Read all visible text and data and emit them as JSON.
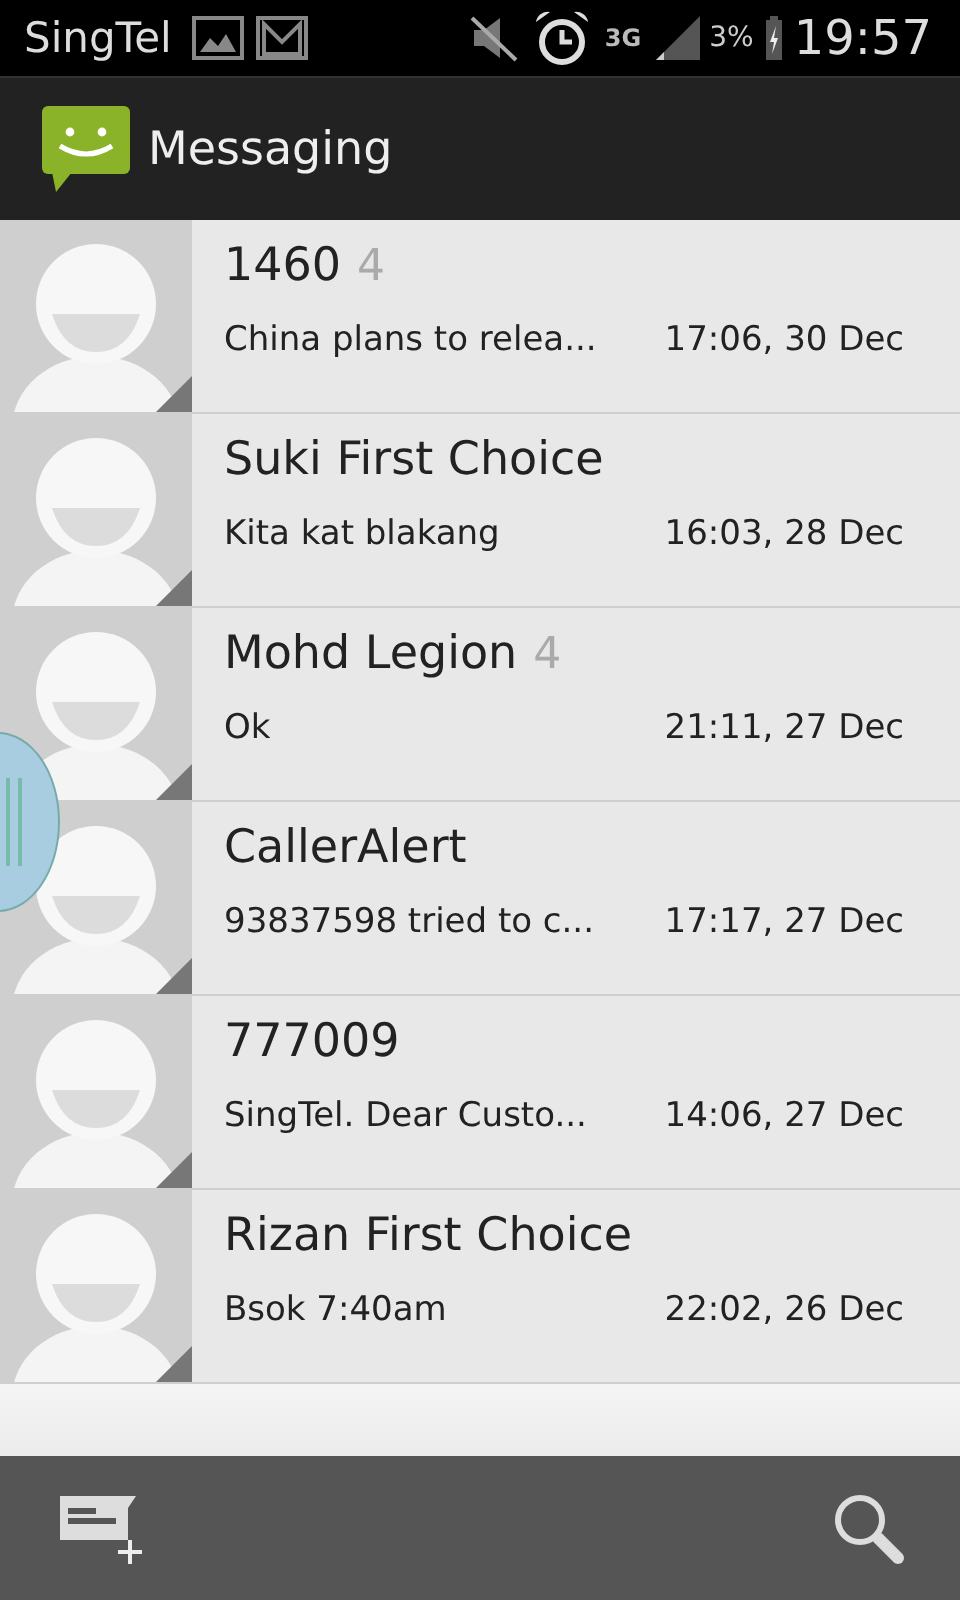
{
  "status_bar": {
    "carrier": "SingTel",
    "network": "3G",
    "battery": "3%",
    "time": "19:57"
  },
  "app_bar": {
    "title": "Messaging"
  },
  "conversations": [
    {
      "name": "1460",
      "count": "4",
      "preview": "China plans to relea...",
      "time": "17:06, 30 Dec"
    },
    {
      "name": "Suki First Choice",
      "preview": "Kita kat blakang",
      "time": "16:03, 28 Dec"
    },
    {
      "name": "Mohd Legion",
      "count": "4",
      "preview": "Ok",
      "time": "21:11, 27 Dec"
    },
    {
      "name": "CallerAlert",
      "preview": "93837598 tried to c...",
      "time": "17:17, 27 Dec"
    },
    {
      "name": "777009",
      "preview": "SingTel. Dear Custo...",
      "time": "14:06, 27 Dec"
    },
    {
      "name": "Rizan First Choice",
      "preview": "Bsok 7:40am",
      "time": "22:02, 26 Dec"
    }
  ]
}
